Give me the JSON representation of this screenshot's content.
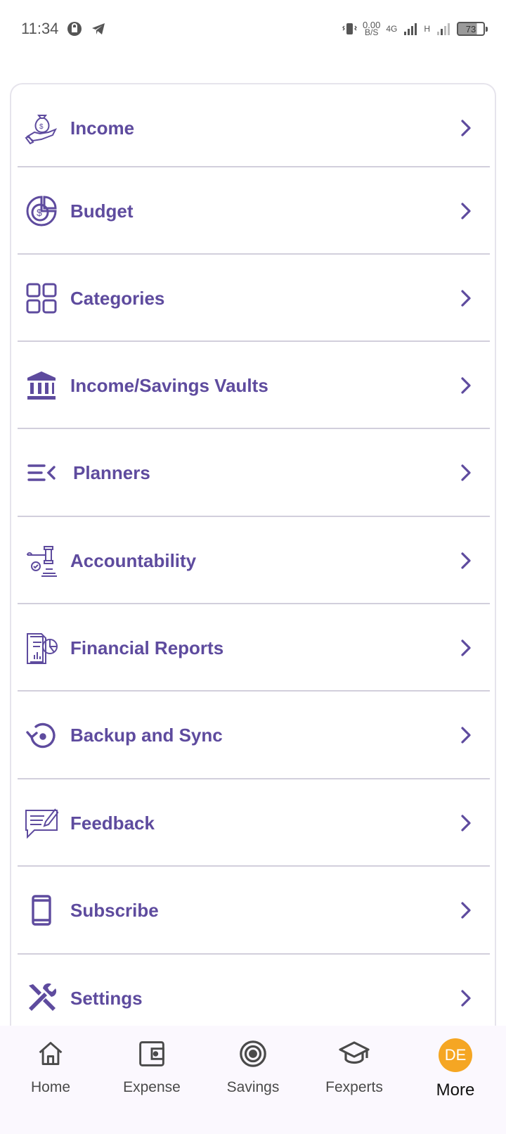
{
  "status_bar": {
    "time": "11:34",
    "net_speed_value": "0.00",
    "net_speed_unit": "B/S",
    "network_type": "4G",
    "signal_label": "H",
    "battery": "73"
  },
  "menu": {
    "items": [
      {
        "label": "Income",
        "icon": "money-bag-hand-icon"
      },
      {
        "label": "Budget",
        "icon": "budget-pie-dollar-icon"
      },
      {
        "label": "Categories",
        "icon": "grid-icon"
      },
      {
        "label": "Income/Savings Vaults",
        "icon": "bank-icon"
      },
      {
        "label": "Planners",
        "icon": "list-collapse-icon"
      },
      {
        "label": "Accountability",
        "icon": "gavel-icon"
      },
      {
        "label": "Financial Reports",
        "icon": "report-chart-icon"
      },
      {
        "label": "Backup and Sync",
        "icon": "history-icon"
      },
      {
        "label": "Feedback",
        "icon": "feedback-icon"
      },
      {
        "label": "Subscribe",
        "icon": "phone-icon"
      },
      {
        "label": "Settings",
        "icon": "tools-icon"
      }
    ]
  },
  "bottom_nav": {
    "items": [
      {
        "label": "Home",
        "icon": "home-icon"
      },
      {
        "label": "Expense",
        "icon": "wallet-icon"
      },
      {
        "label": "Savings",
        "icon": "target-icon"
      },
      {
        "label": "Fexperts",
        "icon": "graduation-cap-icon"
      },
      {
        "label": "More",
        "icon": "avatar",
        "avatar_text": "DE",
        "active": true
      }
    ]
  },
  "colors": {
    "accent": "#5e4b9e",
    "avatar": "#f5a623",
    "nav_background": "#fbf8fe"
  }
}
